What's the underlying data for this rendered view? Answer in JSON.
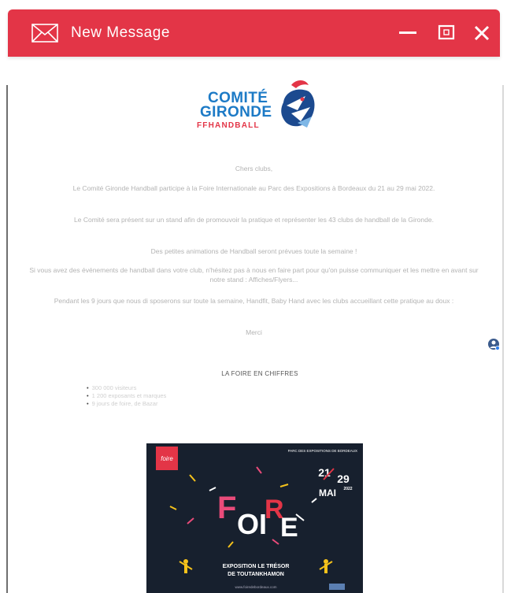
{
  "window": {
    "title": "New Message",
    "icons": [
      "envelope-icon",
      "minimize-icon",
      "maximize-icon",
      "close-icon"
    ],
    "accent_color": "#e33547"
  },
  "logo": {
    "line1": "COMITÉ",
    "line2": "GIRONDE",
    "line3": "FFHANDBALL"
  },
  "message": {
    "greeting": "Chers clubs,",
    "paragraphs": [
      "Le Comité Gironde Handball participe à la Foire Internationale au Parc des Expositions à Bordeaux du 21 au 29 mai 2022.",
      "Le Comité sera présent sur un stand afin de promouvoir la pratique et représenter les 43 clubs de handball de la Gironde.",
      "Des petites animations de Handball seront prévues toute la semaine !",
      "Si vous avez des événements de handball dans votre club, n'hésitez pas à nous en faire part pour qu'on puisse communiquer et les mettre en avant sur notre stand : Affiches/Flyers...",
      "Pendant les 9 jours que nous di sposerons sur toute la semaine, Handfit, Baby Hand avec les clubs accueillant cette pratique au doux :"
    ],
    "signature": "Merci"
  },
  "section": {
    "heading": "LA FOIRE EN CHIFFRES",
    "bullets": [
      "300 000 visiteurs",
      "1 200 exposants et marques",
      "9 jours de foire, de Bazar"
    ]
  },
  "poster": {
    "venue": "PARC DES EXPOSITIONS DE BORDEAUX",
    "badge": "foire",
    "day_start": "21",
    "day_end": "29",
    "month": "MAI",
    "year": "2022",
    "word_f": "F",
    "word_oi": "OI",
    "word_r": "R",
    "word_e": "E",
    "expo_line1": "EXPOSITION LE TRÉSOR",
    "expo_line2": "DE TOUTANKHAMON",
    "url": "www.foiredebordeaux.com",
    "colors": {
      "background": "#17202e",
      "red": "#e33547",
      "yellow": "#f5c21b",
      "pink": "#e94b7a",
      "white": "#ffffff"
    }
  }
}
